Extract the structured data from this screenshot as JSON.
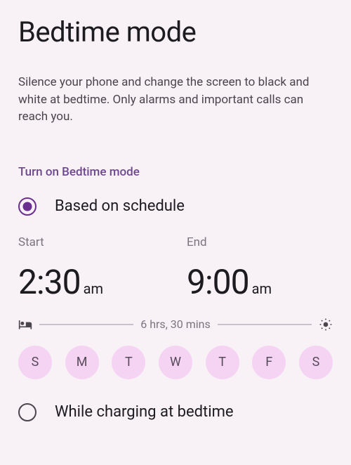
{
  "title": "Bedtime mode",
  "description": "Silence your phone and change the screen to black and white at bedtime. Only alarms and important calls can reach you.",
  "sectionLabel": "Turn on Bedtime mode",
  "options": {
    "schedule": {
      "label": "Based on schedule",
      "selected": true
    },
    "charging": {
      "label": "While charging at bedtime",
      "selected": false
    }
  },
  "schedule": {
    "startLabel": "Start",
    "endLabel": "End",
    "start": {
      "time": "2:30",
      "ampm": "am"
    },
    "end": {
      "time": "9:00",
      "ampm": "am"
    },
    "duration": "6 hrs, 30 mins",
    "days": [
      "S",
      "M",
      "T",
      "W",
      "T",
      "F",
      "S"
    ]
  }
}
